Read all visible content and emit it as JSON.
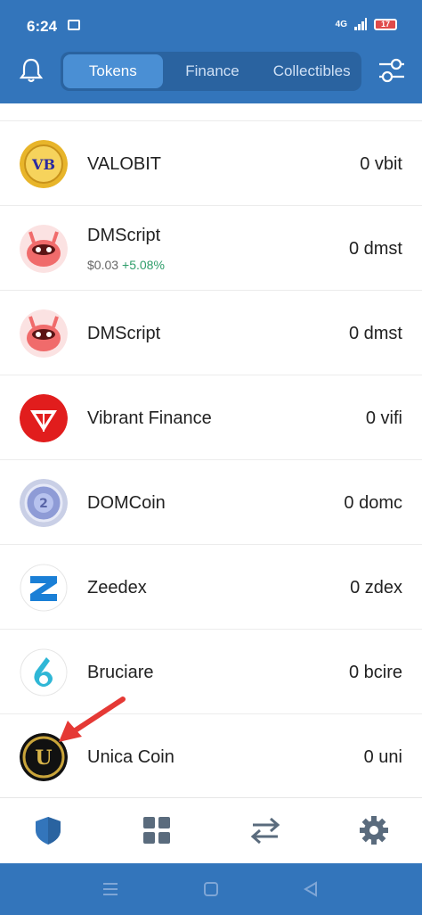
{
  "status_bar": {
    "time": "6:24",
    "network": "4G",
    "battery": "17"
  },
  "tabs": [
    {
      "label": "Tokens",
      "active": true
    },
    {
      "label": "Finance",
      "active": false
    },
    {
      "label": "Collectibles",
      "active": false
    }
  ],
  "tokens": [
    {
      "name": "VALOBIT",
      "balance": "0 vbit",
      "logo": "valobit-logo"
    },
    {
      "name": "DMScript",
      "price": "$0.03",
      "change": "+5.08%",
      "balance": "0 dmst",
      "logo": "dmscript-logo"
    },
    {
      "name": "DMScript",
      "balance": "0 dmst",
      "logo": "dmscript-logo"
    },
    {
      "name": "Vibrant Finance",
      "balance": "0 vifi",
      "logo": "vibrant-finance-logo"
    },
    {
      "name": "DOMCoin",
      "balance": "0 domc",
      "logo": "domcoin-logo"
    },
    {
      "name": "Zeedex",
      "balance": "0 zdex",
      "logo": "zeedex-logo"
    },
    {
      "name": "Bruciare",
      "balance": "0 bcire",
      "logo": "bruciare-logo"
    },
    {
      "name": "Unica Coin",
      "balance": "0 uni",
      "logo": "unica-coin-logo"
    }
  ],
  "bottom_nav": [
    {
      "icon": "shield-icon",
      "active": true
    },
    {
      "icon": "grid-icon",
      "active": false
    },
    {
      "icon": "swap-icon",
      "active": false
    },
    {
      "icon": "settings-gear-icon",
      "active": false
    }
  ],
  "colors": {
    "primary": "#3375bb",
    "positive": "#2e9d6a",
    "arrow": "#e53935"
  }
}
